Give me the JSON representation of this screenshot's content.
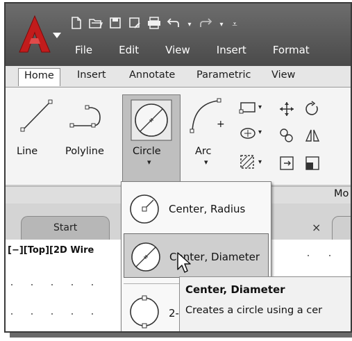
{
  "quick_access": [
    "new-icon",
    "open-icon",
    "save-icon",
    "save-as-icon",
    "plot-icon",
    "undo-icon",
    "redo-icon",
    "customize-icon"
  ],
  "menubar": [
    "File",
    "Edit",
    "View",
    "Insert",
    "Format"
  ],
  "ribbon_tabs": [
    "Home",
    "Insert",
    "Annotate",
    "Parametric",
    "View"
  ],
  "tools": {
    "line": "Line",
    "polyline": "Polyline",
    "circle": "Circle",
    "arc": "Arc"
  },
  "panel_label": "Mo",
  "file_tab": "Start",
  "viewport_controls": "[−][Top][2D Wire",
  "dropdown": {
    "items": [
      "Center, Radius",
      "Center, Diameter",
      "2-"
    ]
  },
  "tooltip": {
    "title": "Center, Diameter",
    "description": "Creates a circle using a cer"
  },
  "colors": {
    "titlebar": "#5a5a5a",
    "highlight": "#cfcfcf",
    "logo": "#c21c1c"
  }
}
